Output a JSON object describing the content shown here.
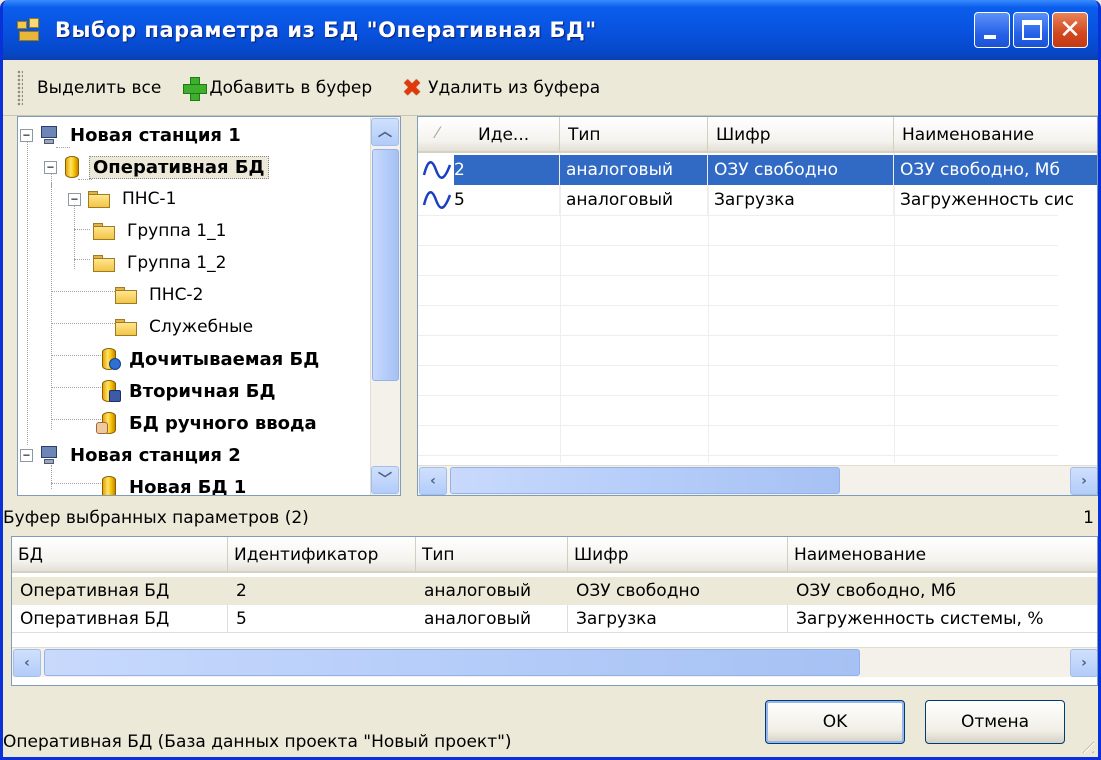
{
  "window": {
    "title": "Выбор параметра из БД \"Оперативная БД\"",
    "icons": [
      "app-icon",
      "minimize-icon",
      "maximize-icon",
      "close-icon"
    ]
  },
  "toolbar": {
    "select_all": "Выделить все",
    "add_to_buffer": "Добавить в буфер",
    "remove_from_buffer": "Удалить из буфера"
  },
  "tree": {
    "items": [
      {
        "label": "Новая станция 1",
        "icon": "computer-icon",
        "bold": true
      },
      {
        "label": "Оперативная БД",
        "icon": "database-icon",
        "bold": true,
        "selected": true
      },
      {
        "label": "ПНС-1",
        "icon": "folder-icon"
      },
      {
        "label": "Группа 1_1",
        "icon": "folder-icon"
      },
      {
        "label": "Группа 1_2",
        "icon": "folder-icon"
      },
      {
        "label": "ПНС-2",
        "icon": "folder-icon"
      },
      {
        "label": "Служебные",
        "icon": "folder-icon"
      },
      {
        "label": "Дочитываемая БД",
        "icon": "database-gear-icon",
        "bold": true
      },
      {
        "label": "Вторичная БД",
        "icon": "database-disk-icon",
        "bold": true
      },
      {
        "label": "БД ручного ввода",
        "icon": "database-hand-icon",
        "bold": true
      },
      {
        "label": "Новая станция 2",
        "icon": "computer-icon",
        "bold": true
      },
      {
        "label": "Новая БД 1",
        "icon": "database-icon",
        "bold": true
      }
    ]
  },
  "params_grid": {
    "columns": [
      "Иде...",
      "Тип",
      "Шифр",
      "Наименование"
    ],
    "rows": [
      {
        "id": "2",
        "type": "аналоговый",
        "code": "ОЗУ свободно",
        "name": "ОЗУ свободно, Мб",
        "selected": true
      },
      {
        "id": "5",
        "type": "аналоговый",
        "code": "Загрузка",
        "name": "Загруженность сис"
      }
    ]
  },
  "buffer": {
    "title": "Буфер выбранных параметров (2)",
    "count": "1",
    "columns": [
      "БД",
      "Идентификатор",
      "Тип",
      "Шифр",
      "Наименование"
    ],
    "rows": [
      {
        "db": "Оперативная БД",
        "id": "2",
        "type": "аналоговый",
        "code": "ОЗУ свободно",
        "name": "ОЗУ свободно, Мб"
      },
      {
        "db": "Оперативная БД",
        "id": "5",
        "type": "аналоговый",
        "code": "Загрузка",
        "name": "Загруженность системы, %"
      }
    ]
  },
  "status": "Оперативная БД (База данных проекта \"Новый проект\")",
  "buttons": {
    "ok": "OK",
    "cancel": "Отмена"
  },
  "colors": {
    "titlebar": "#0853E0",
    "selection": "#316AC5",
    "window_bg": "#ECE9D8"
  }
}
